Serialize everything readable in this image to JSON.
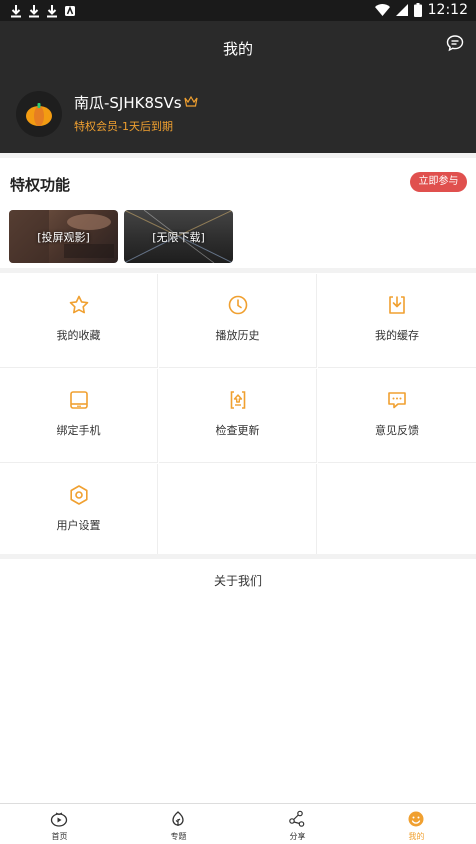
{
  "status": {
    "time": "12:12"
  },
  "header": {
    "title": "我的"
  },
  "user": {
    "name": "南瓜-SJHK8SVs",
    "membership": "特权会员-1天后到期"
  },
  "privileges": {
    "title": "特权功能",
    "join_label": "立即参与",
    "cards": [
      {
        "label": "[投屏观影]"
      },
      {
        "label": "[无限下载]"
      }
    ]
  },
  "grid": [
    {
      "label": "我的收藏",
      "icon": "star-icon"
    },
    {
      "label": "播放历史",
      "icon": "clock-icon"
    },
    {
      "label": "我的缓存",
      "icon": "download-icon"
    },
    {
      "label": "绑定手机",
      "icon": "tablet-icon"
    },
    {
      "label": "检查更新",
      "icon": "update-icon"
    },
    {
      "label": "意见反馈",
      "icon": "feedback-icon"
    },
    {
      "label": "用户设置",
      "icon": "settings-icon"
    }
  ],
  "about": {
    "label": "关于我们"
  },
  "tabs": [
    {
      "label": "首页",
      "icon": "play-icon"
    },
    {
      "label": "专题",
      "icon": "topic-icon"
    },
    {
      "label": "分享",
      "icon": "share-icon"
    },
    {
      "label": "我的",
      "icon": "mine-icon",
      "active": true
    }
  ],
  "colors": {
    "accent": "#f0a030",
    "join": "#e0504e",
    "header_bg": "#2a2a2a"
  }
}
